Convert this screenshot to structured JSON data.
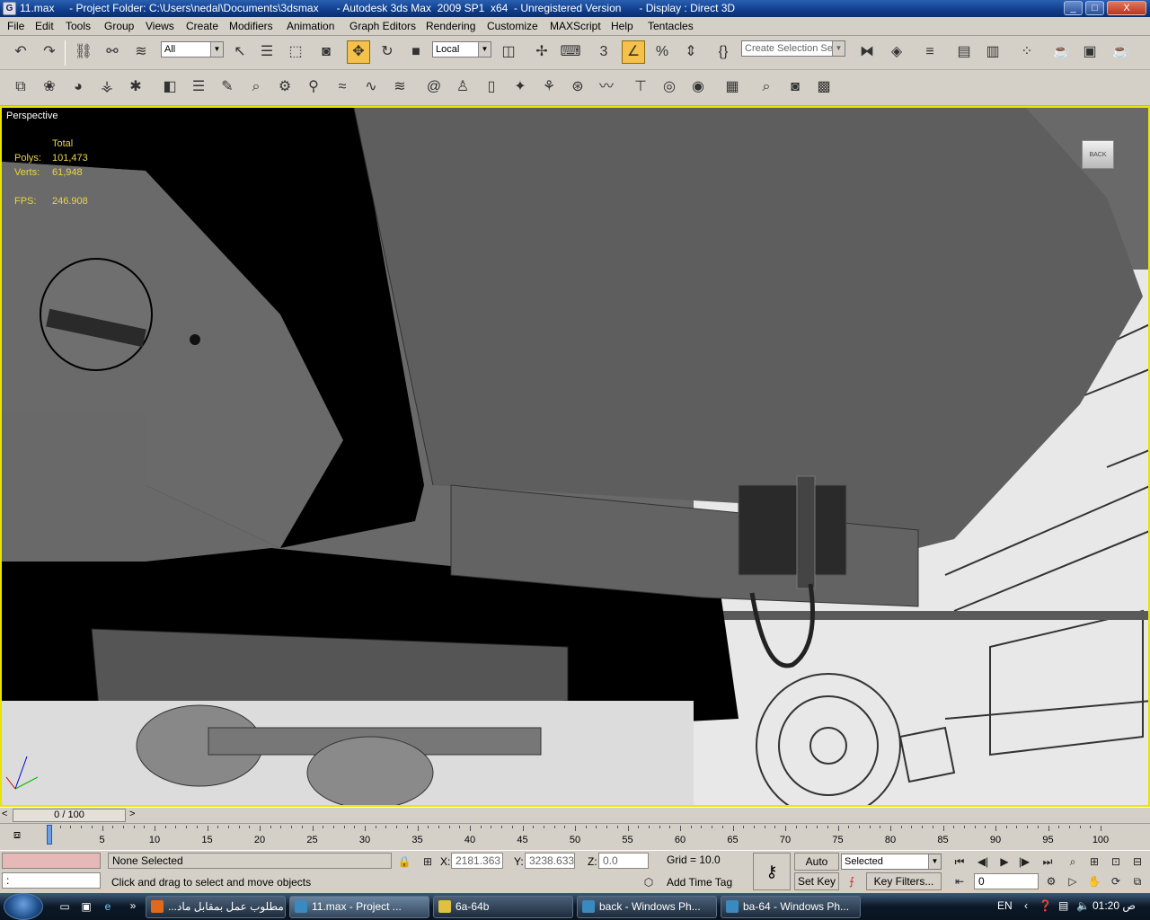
{
  "window": {
    "title": "11.max     - Project Folder: C:\\Users\\nedal\\Documents\\3dsmax      - Autodesk 3ds Max  2009 SP1  x64  - Unregistered Version      - Display : Direct 3D",
    "controls": [
      "_",
      "□",
      "X"
    ]
  },
  "menu": [
    "File",
    "Edit",
    "Tools",
    "Group",
    "Views",
    "Create",
    "Modifiers",
    "Animation",
    "Graph Editors",
    "Rendering",
    "Customize",
    "MAXScript",
    "Help",
    "Tentacles"
  ],
  "toolbar": {
    "filter_value": "All",
    "coord_value": "Local",
    "selection_set_placeholder": "Create Selection Set",
    "snap_label": "3",
    "percent_snap_label": "%"
  },
  "viewport": {
    "label": "Perspective",
    "stats_header": "Total",
    "polys_label": "Polys:",
    "polys_value": "101,473",
    "verts_label": "Verts:",
    "verts_value": "61,948",
    "fps_label": "FPS:",
    "fps_value": "246.908",
    "viewcube_label": "BACK"
  },
  "timeline": {
    "slider_text": "0 / 100",
    "ticks": [
      "0",
      "5",
      "10",
      "15",
      "20",
      "25",
      "30",
      "35",
      "40",
      "45",
      "50",
      "55",
      "60",
      "65",
      "70",
      "75",
      "80",
      "85",
      "90",
      "95",
      "100"
    ]
  },
  "status": {
    "selection": "None Selected",
    "prompt": "Click and drag to select and move objects",
    "script_prompt": ":",
    "x_label": "X:",
    "x_value": "2181.363",
    "y_label": "Y:",
    "y_value": "3238.633",
    "z_label": "Z:",
    "z_value": "0.0",
    "grid": "Grid = 10.0",
    "add_time_tag": "Add Time Tag",
    "auto_key": "Auto Key",
    "set_key": "Set Key",
    "key_mode": "Selected",
    "key_filters": "Key Filters...",
    "frame_value": "0"
  },
  "taskbar": {
    "tasks": [
      {
        "label": "...مطلوب عمل بمقابل ماد",
        "color": "#e06a1a"
      },
      {
        "label": "11.max     - Project ...",
        "color": "#3a8ac0"
      },
      {
        "label": "6a-64b",
        "color": "#e0c040"
      },
      {
        "label": "back - Windows Ph...",
        "color": "#3a8ac0"
      },
      {
        "label": "ba-64 - Windows Ph...",
        "color": "#3a8ac0"
      }
    ],
    "lang": "EN",
    "time": "01:20 ص"
  },
  "colors": {
    "titlebar": "#0f3d8c",
    "viewport_bg": "#696969",
    "viewport_border": "#e6e600",
    "stats_text": "#e8d44a",
    "active_tool": "#f5c14a"
  }
}
